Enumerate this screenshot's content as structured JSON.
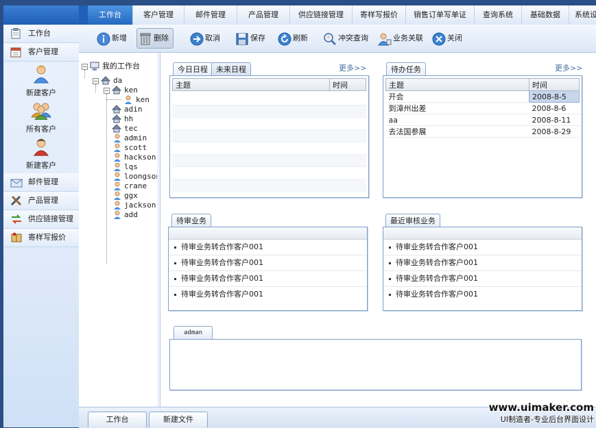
{
  "sidebar": {
    "items": [
      {
        "label": "工作台",
        "icon": "clipboard-icon"
      },
      {
        "label": "客户管理",
        "icon": "calendar-icon"
      }
    ],
    "sub_items": [
      {
        "label": "新建客户",
        "icon": "user-icon"
      },
      {
        "label": "所有客户",
        "icon": "users-group-icon"
      },
      {
        "label": "新建客户",
        "icon": "user-red-icon"
      }
    ],
    "more_items": [
      {
        "label": "邮件管理",
        "icon": "mail-icon"
      },
      {
        "label": "产品管理",
        "icon": "tools-icon"
      },
      {
        "label": "供应链接管理",
        "icon": "exchange-icon"
      },
      {
        "label": "寄样写报价",
        "icon": "book-icon"
      }
    ]
  },
  "topnav": {
    "tabs": [
      "工作台",
      "客户管理",
      "邮件管理",
      "产品管理",
      "供应链接管理",
      "寄样写报价",
      "销售订单写单证",
      "查询系统",
      "基础数据",
      "系统设置"
    ],
    "active": 0
  },
  "toolbar": {
    "new": "新增",
    "delete": "删除",
    "cancel": "取消",
    "save": "保存",
    "refresh": "刷新",
    "conflict": "冲突查询",
    "link": "业务关联",
    "close": "关闭"
  },
  "tree": {
    "root": "我的工作台",
    "nodes": [
      "da",
      "ken",
      "ken",
      "adin",
      "hh",
      "tec",
      "admin",
      "scott",
      "hackson",
      "lqs",
      "loongson",
      "crane",
      "ggx",
      "jackson",
      "add"
    ]
  },
  "schedule": {
    "tab_today": "今日日程",
    "tab_future": "未来日程",
    "more": "更多>>",
    "col_subject": "主题",
    "col_time": "时间"
  },
  "todo": {
    "tab": "待办任务",
    "more": "更多>>",
    "col_subject": "主题",
    "col_time": "时间",
    "rows": [
      {
        "subject": "开会",
        "time": "2008-8-5"
      },
      {
        "subject": "到漳州出差",
        "time": "2008-8-6"
      },
      {
        "subject": "aa",
        "time": "2008-8-11"
      },
      {
        "subject": "去法国参展",
        "time": "2008-8-29"
      }
    ]
  },
  "pending": {
    "tab": "待审业务",
    "items": [
      "待审业务转合作客户001",
      "待审业务转合作客户001",
      "待审业务转合作客户001",
      "待审业务转合作客户001"
    ]
  },
  "recent": {
    "tab": "最近审核业务",
    "items": [
      "待审业务转合作客户001",
      "待审业务转合作客户001",
      "待审业务转合作客户001",
      "待审业务转合作客户001"
    ]
  },
  "admin_panel": {
    "tab": "adman"
  },
  "bottom": {
    "tabs": [
      "工作台",
      "新建文件"
    ]
  },
  "watermark": {
    "line1": "www.uimaker.com",
    "line2": "UI制造者-专业后台界面设计"
  },
  "colors": {
    "accent": "#2468c0",
    "frame": "#2a4f86",
    "selection": "#c7d6ec"
  }
}
